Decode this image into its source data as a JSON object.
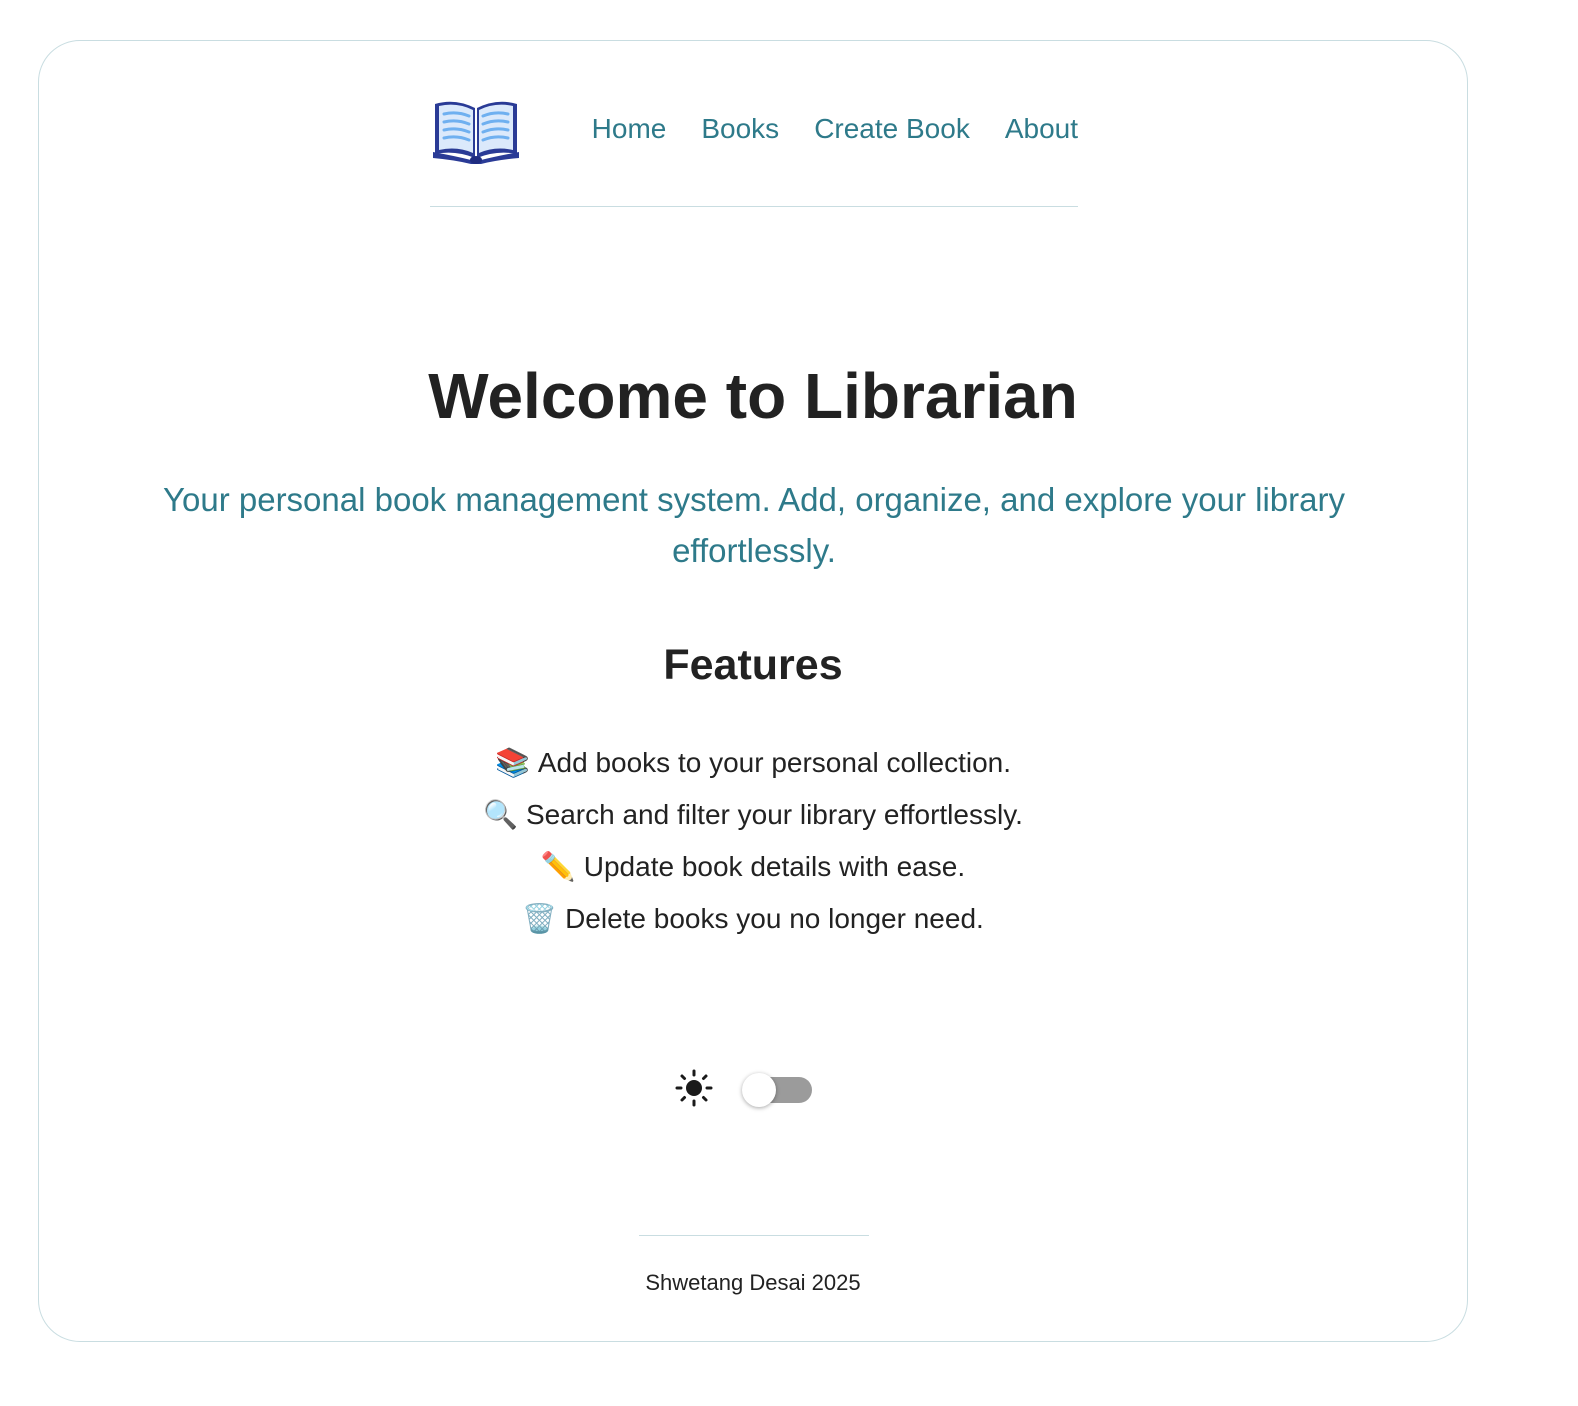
{
  "header": {
    "logo_icon": "open-book-icon",
    "nav": [
      {
        "label": "Home"
      },
      {
        "label": "Books"
      },
      {
        "label": "Create Book"
      },
      {
        "label": "About"
      }
    ]
  },
  "main": {
    "title": "Welcome to Librarian",
    "subtitle": "Your personal book management system. Add, organize, and explore your library effortlessly.",
    "features_heading": "Features",
    "features": [
      {
        "emoji": "📚",
        "icon": "books-icon",
        "text": "Add books to your personal collection."
      },
      {
        "emoji": "🔍",
        "icon": "magnifying-glass-icon",
        "text": "Search and filter your library effortlessly."
      },
      {
        "emoji": "✏️",
        "icon": "pencil-icon",
        "text": "Update book details with ease."
      },
      {
        "emoji": "🗑️",
        "icon": "trash-icon",
        "text": "Delete books you no longer need."
      }
    ]
  },
  "theme": {
    "icon": "sun-icon",
    "toggle_state": "off"
  },
  "footer": {
    "text": "Shwetang Desai 2025"
  },
  "colors": {
    "accent": "#2e7a8a",
    "text": "#222222",
    "border": "#c9dde1",
    "toggle_track": "#9b9b9b"
  }
}
